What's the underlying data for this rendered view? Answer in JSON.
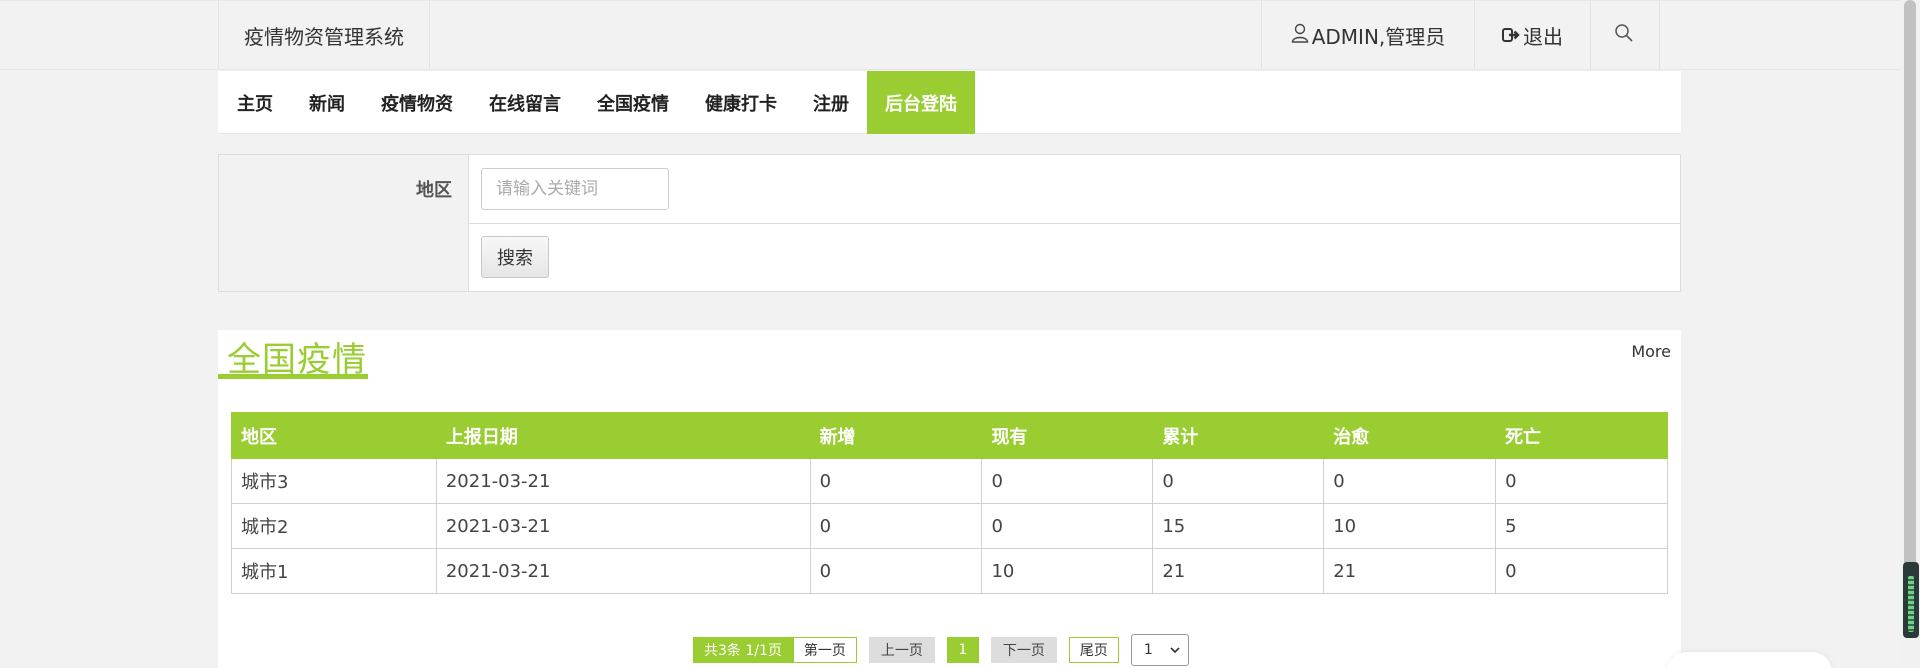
{
  "header": {
    "brand": "疫情物资管理系统",
    "user": "ADMIN,管理员",
    "logout": "退出"
  },
  "nav": {
    "items": [
      {
        "label": "主页"
      },
      {
        "label": "新闻"
      },
      {
        "label": "疫情物资"
      },
      {
        "label": "在线留言"
      },
      {
        "label": "全国疫情"
      },
      {
        "label": "健康打卡"
      },
      {
        "label": "注册"
      },
      {
        "label": "后台登陆"
      }
    ],
    "active_index": 7
  },
  "search": {
    "region_label": "地区",
    "placeholder": "请输入关键词",
    "value": "",
    "button": "搜索"
  },
  "panel": {
    "title": "全国疫情",
    "more": "More",
    "columns": [
      "地区",
      "上报日期",
      "新增",
      "现有",
      "累计",
      "治愈",
      "死亡"
    ],
    "rows": [
      [
        "城市3",
        "2021-03-21",
        "0",
        "0",
        "0",
        "0",
        "0"
      ],
      [
        "城市2",
        "2021-03-21",
        "0",
        "0",
        "15",
        "10",
        "5"
      ],
      [
        "城市1",
        "2021-03-21",
        "0",
        "10",
        "21",
        "21",
        "0"
      ]
    ]
  },
  "pager": {
    "total": "共3条 1/1页",
    "first": "第一页",
    "prev": "上一页",
    "current": "1",
    "next": "下一页",
    "last": "尾页",
    "select_value": "1"
  },
  "colors": {
    "accent": "#9acd32"
  }
}
